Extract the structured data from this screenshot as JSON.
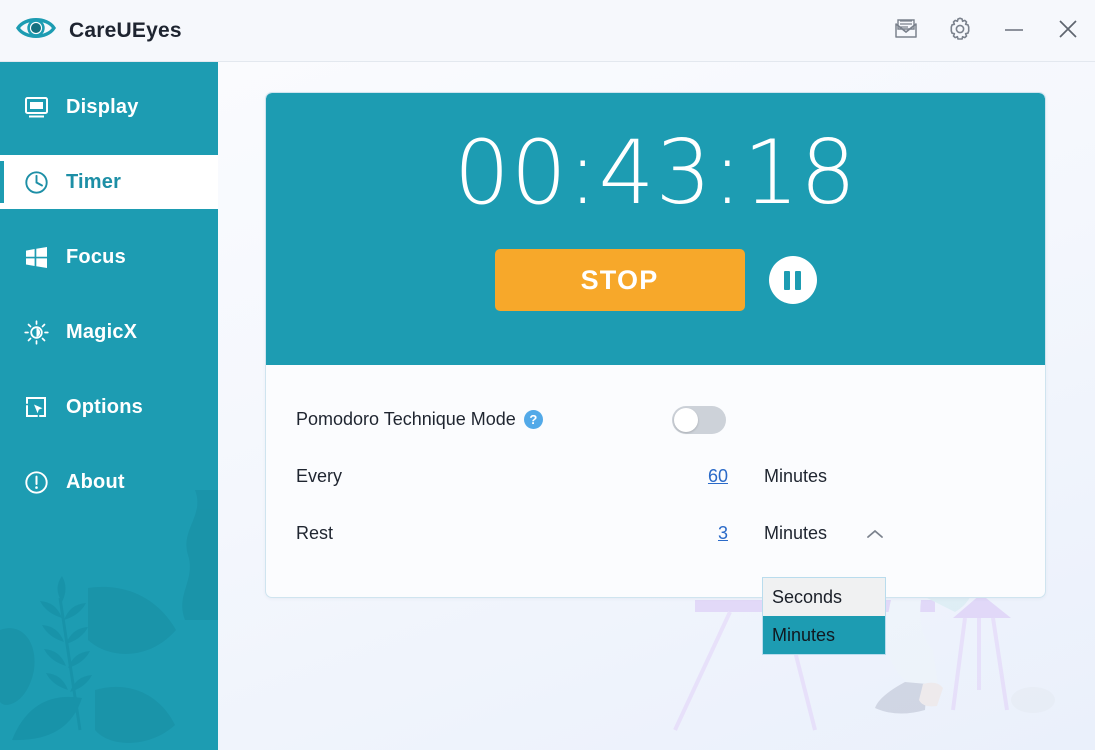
{
  "window": {
    "app_title": "CareUEyes",
    "logo_icon": "eye-icon",
    "buttons": [
      {
        "name": "feedback-mail-button",
        "icon": "envelope-icon",
        "label": ""
      },
      {
        "name": "settings-button",
        "icon": "gear-icon",
        "label": ""
      },
      {
        "name": "minimize-button",
        "icon": "minimize-icon",
        "label": ""
      },
      {
        "name": "close-button",
        "icon": "close-icon",
        "label": ""
      }
    ]
  },
  "sidebar": {
    "items": [
      {
        "label": "Display",
        "icon": "monitor-icon",
        "active": false
      },
      {
        "label": "Timer",
        "icon": "clock-icon",
        "active": true
      },
      {
        "label": "Focus",
        "icon": "windows-grid-icon",
        "active": false
      },
      {
        "label": "MagicX",
        "icon": "brightness-icon",
        "active": false
      },
      {
        "label": "Options",
        "icon": "cursor-square-icon",
        "active": false
      },
      {
        "label": "About",
        "icon": "info-circle-icon",
        "active": false
      }
    ]
  },
  "timer": {
    "display": "00:43:18",
    "stop_label": "STOP",
    "pause_icon": "pause-icon"
  },
  "settings": {
    "pomodoro": {
      "label": "Pomodoro Technique Mode",
      "help_icon": "question-mark-icon",
      "help_glyph": "?",
      "toggle_state": "off"
    },
    "every": {
      "label": "Every",
      "value": "60",
      "unit": "Minutes"
    },
    "rest": {
      "label": "Rest",
      "value": "3",
      "unit": "Minutes",
      "caret_icon": "chevron-up-icon"
    },
    "unit_dropdown": {
      "open": true,
      "options": [
        {
          "label": "Seconds",
          "selected": false
        },
        {
          "label": "Minutes",
          "selected": true
        }
      ]
    }
  },
  "colors": {
    "brand_teal": "#1d9cb2",
    "accent_orange": "#f7a82a",
    "link_blue": "#2a6ac8",
    "help_blue": "#52a9e8",
    "titlebar_bg": "#f6f8fc",
    "card_bg": "#fbfcfe"
  }
}
